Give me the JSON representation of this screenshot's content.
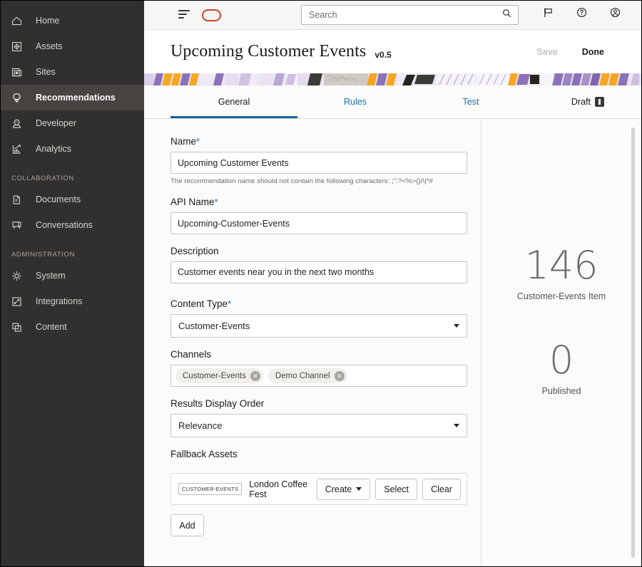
{
  "sidebar": {
    "items": [
      {
        "label": "Home",
        "icon": "home-icon",
        "active": false
      },
      {
        "label": "Assets",
        "icon": "assets-icon",
        "active": false
      },
      {
        "label": "Sites",
        "icon": "sites-icon",
        "active": false
      },
      {
        "label": "Recommendations",
        "icon": "lightbulb-icon",
        "active": true
      },
      {
        "label": "Developer",
        "icon": "developer-icon",
        "active": false
      },
      {
        "label": "Analytics",
        "icon": "analytics-icon",
        "active": false
      }
    ],
    "sections": [
      {
        "title": "COLLABORATION",
        "items": [
          {
            "label": "Documents",
            "icon": "documents-icon"
          },
          {
            "label": "Conversations",
            "icon": "conversations-icon"
          }
        ]
      },
      {
        "title": "ADMINISTRATION",
        "items": [
          {
            "label": "System",
            "icon": "gear-icon"
          },
          {
            "label": "Integrations",
            "icon": "integrations-icon"
          },
          {
            "label": "Content",
            "icon": "content-icon"
          }
        ]
      }
    ]
  },
  "topbar": {
    "menu_icon": "hamburger-icon",
    "logo": "oracle-logo",
    "search": {
      "value": "",
      "placeholder": "Search",
      "icon": "search-icon"
    },
    "icons": [
      "flag-icon",
      "help-icon",
      "user-avatar-icon"
    ]
  },
  "header": {
    "title": "Upcoming Customer Events",
    "version": "v0.5",
    "save_label": "Save",
    "done_label": "Done"
  },
  "tabs": {
    "items": [
      {
        "label": "General",
        "active": true
      },
      {
        "label": "Rules",
        "active": false
      },
      {
        "label": "Test",
        "active": false
      }
    ],
    "status_label": "Draft",
    "status_badge_icon": "info-badge-icon"
  },
  "form": {
    "name": {
      "label": "Name",
      "required": "*",
      "value": "Upcoming Customer Events",
      "helper": "The recommendation name should not contain the following characters: ;\":?<%>{}/\\|*#"
    },
    "api_name": {
      "label": "API Name",
      "required": "*",
      "value": "Upcoming-Customer-Events"
    },
    "description": {
      "label": "Description",
      "value": "Customer events near you in the next two months"
    },
    "content_type": {
      "label": "Content Type",
      "required": "*",
      "value": "Customer-Events"
    },
    "channels": {
      "label": "Channels",
      "chips": [
        "Customer-Events",
        "Demo Channel"
      ],
      "remove_icon": "close-circle-icon"
    },
    "results_display_order": {
      "label": "Results Display Order",
      "value": "Relevance"
    },
    "fallback_assets": {
      "label": "Fallback Assets",
      "rows": [
        {
          "type_badge": "CUSTOMER-EVENTS",
          "asset_name": "London Coffee Fest",
          "create_label": "Create",
          "select_label": "Select",
          "clear_label": "Clear"
        }
      ],
      "add_label": "Add"
    }
  },
  "stats": [
    {
      "value": "146",
      "label": "Customer-Events Item"
    },
    {
      "value": "0",
      "label": "Published"
    }
  ],
  "colors": {
    "sidebar_bg": "#32302e",
    "sidebar_active": "#474340",
    "accent_blue": "#1a6fb5",
    "tab_underline": "#17639e",
    "oracle_red": "#c74634",
    "banner_purple": "#8b72b8",
    "banner_orange": "#f5a623"
  }
}
